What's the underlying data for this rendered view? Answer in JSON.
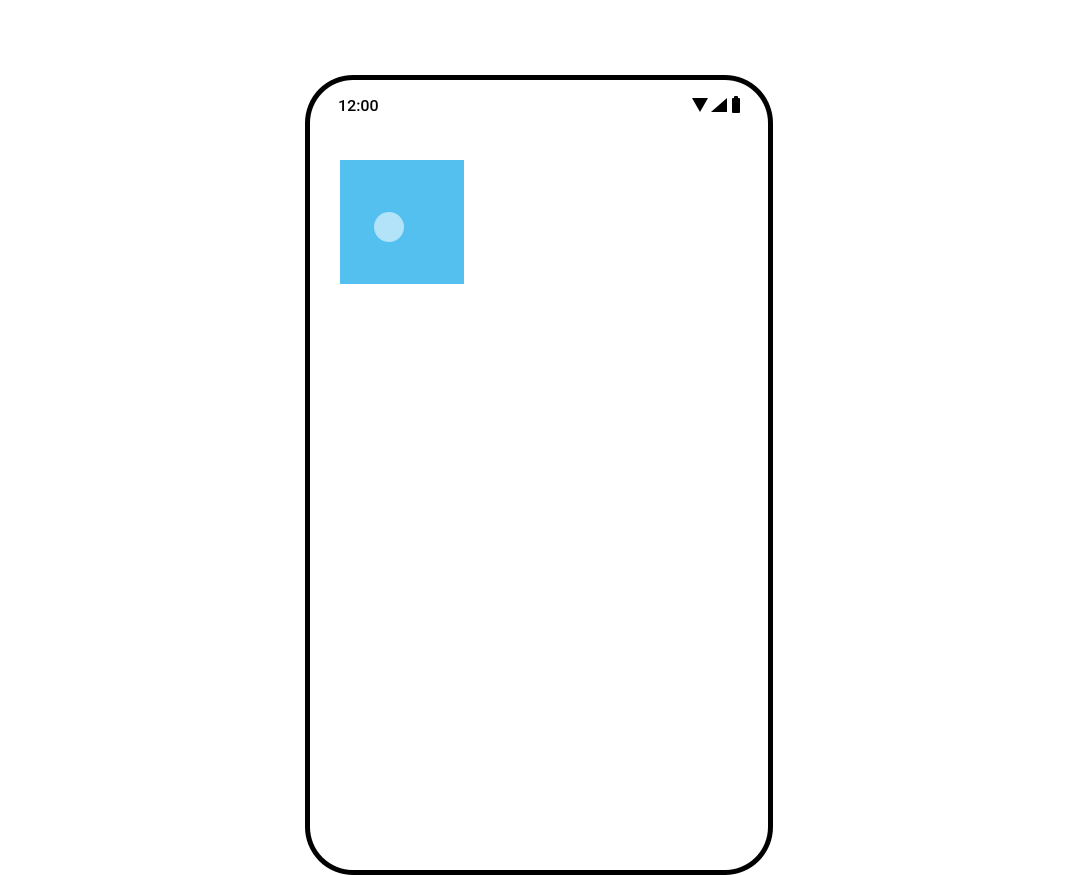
{
  "statusBar": {
    "time": "12:00"
  },
  "colors": {
    "boxColor": "#54c0ef",
    "frameBorder": "#000000",
    "rippleColor": "rgba(255,255,255,0.55)"
  }
}
